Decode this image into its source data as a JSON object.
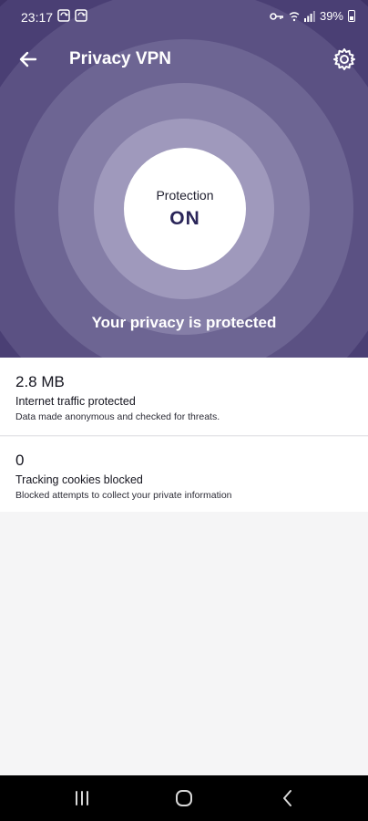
{
  "status_bar": {
    "time": "23:17",
    "notification_icons": [
      "sync-icon",
      "sync-icon"
    ],
    "right_icons": [
      "vpn-key-icon",
      "wifi-icon",
      "signal-icon"
    ],
    "battery": "39%"
  },
  "header": {
    "title": "Privacy VPN",
    "back_icon": "back-arrow-icon",
    "settings_icon": "gear-icon"
  },
  "protection": {
    "label": "Protection",
    "state": "ON",
    "message": "Your privacy is protected"
  },
  "stats": [
    {
      "value": "2.8 MB",
      "title": "Internet traffic protected",
      "description": "Data made anonymous and checked for threats."
    },
    {
      "value": "0",
      "title": "Tracking cookies blocked",
      "description": "Blocked attempts to collect your private information"
    }
  ],
  "colors": {
    "hero_background": "#3e3266",
    "ring_light": "#9f99bc",
    "accent_text": "#2a2559",
    "content_background": "#f5f5f6"
  },
  "navigation_bar": {
    "buttons": [
      "recent-apps-icon",
      "home-icon",
      "back-icon"
    ]
  }
}
